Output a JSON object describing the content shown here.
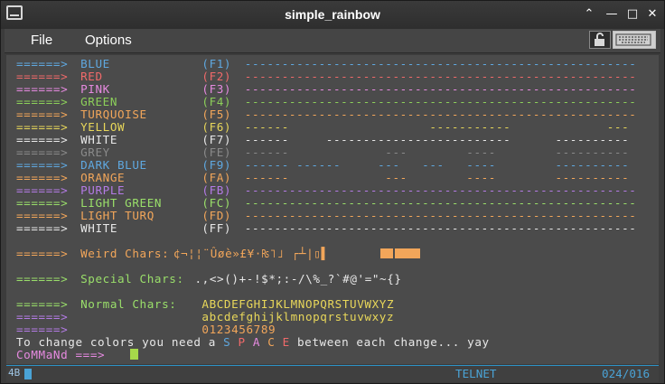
{
  "window": {
    "title": "simple_rainbow"
  },
  "menu": {
    "file": "File",
    "options": "Options"
  },
  "colors": {
    "blue": "#5fa8e0",
    "red": "#f06a6a",
    "pink": "#e68ae0",
    "green": "#8ccf5a",
    "orange": "#f2a65a",
    "yellow": "#e8d75a",
    "white": "#e8e8e8",
    "grey": "#8a8a8a",
    "purple": "#b47be6",
    "lightgreen": "#9adf6a",
    "status": "#4aa3d6"
  },
  "terminal": {
    "arrow": "======>",
    "rows": [
      {
        "name": "BLUE",
        "key": "(F1)",
        "color": "blue",
        "line": "-----------------------------------------------------"
      },
      {
        "name": "RED",
        "key": "(F2)",
        "color": "red",
        "line": "-----------------------------------------------------"
      },
      {
        "name": "PINK",
        "key": "(F3)",
        "color": "pink",
        "line": "-----------------------------------------------------"
      },
      {
        "name": "GREEN",
        "key": "(F4)",
        "color": "green",
        "line": "-----------------------------------------------------"
      },
      {
        "name": "TURQUOISE",
        "key": "(F5)",
        "color": "orange",
        "line": "-----------------------------------------------------"
      },
      {
        "name": "YELLOW",
        "key": "(F6)",
        "color": "yellow",
        "line": "------                   -----------             ---"
      },
      {
        "name": "WHITE",
        "key": "(F7)",
        "color": "white",
        "line": "------     -------------------------      ----------"
      },
      {
        "name": "GREY",
        "key": "(FE)",
        "color": "grey",
        "line": "------             ---        ----        ----------"
      },
      {
        "name": "DARK BLUE",
        "key": "(F9)",
        "color": "blue",
        "line": "------ ------     ---   ---   ----        ----------"
      },
      {
        "name": "ORANGE",
        "key": "(FA)",
        "color": "orange",
        "line": "------             ---        ----        ----------"
      },
      {
        "name": "PURPLE",
        "key": "(FB)",
        "color": "purple",
        "line": "-----------------------------------------------------"
      },
      {
        "name": "LIGHT GREEN",
        "key": "(FC)",
        "color": "lightgreen",
        "line": "-----------------------------------------------------"
      },
      {
        "name": "LIGHT TURQ",
        "key": "(FD)",
        "color": "orange",
        "line": "-----------------------------------------------------"
      },
      {
        "name": "WHITE",
        "key": "(FF)",
        "color": "white",
        "line": "-----------------------------------------------------"
      }
    ],
    "weird_label": "Weird Chars:",
    "weird_chars": "¢¬¦¦¨Ûøè»£¥·₨˥˩ ┌┴|▯▌",
    "special_label": "Special Chars:",
    "special_chars": ".,<>()+-!$*;:-/\\%_?`#@'=\"~{}",
    "normal_label": "Normal Chars:",
    "normal_upper": "ABCDEFGHIJKLMNOPQRSTUVWXYZ",
    "normal_lower": "abcdefghijklmnopqrstuvwxyz",
    "normal_digits": "0123456789",
    "msg_before": "To change colors you need a ",
    "msg_space": [
      "S",
      "P",
      "A",
      "C",
      "E"
    ],
    "msg_after": " between each change... yay",
    "prompt": "CoMMaNd ===>"
  },
  "status": {
    "mode": "TELNET",
    "position": "024/016"
  }
}
